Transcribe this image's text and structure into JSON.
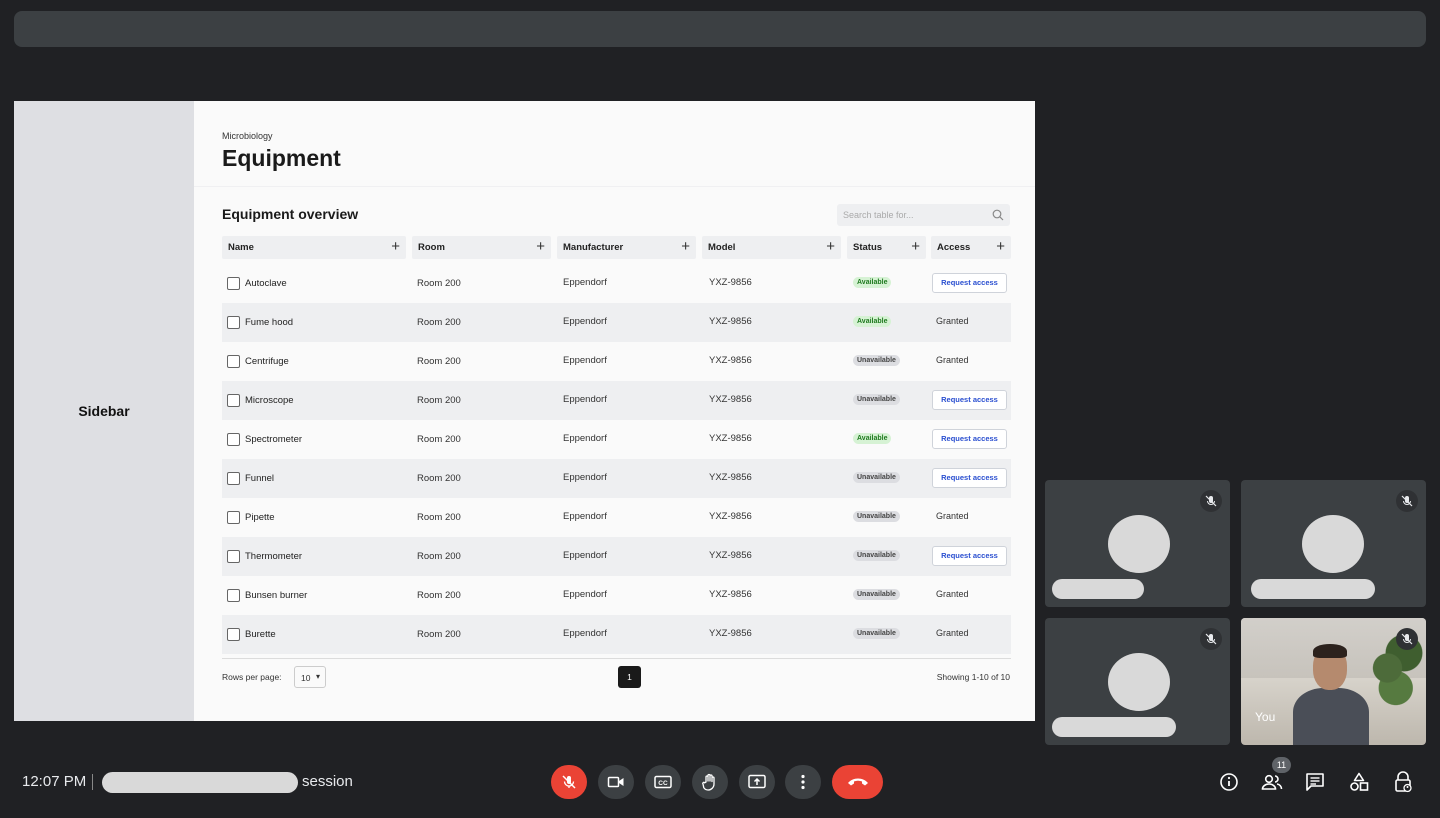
{
  "screen": {
    "sidebar_label": "Sidebar",
    "breadcrumb": "Microbiology",
    "title": "Equipment",
    "section_title": "Equipment overview",
    "search_placeholder": "Search table for...",
    "columns": [
      "Name",
      "Room",
      "Manufacturer",
      "Model",
      "Status",
      "Access"
    ],
    "rows": [
      {
        "name": "Autoclave",
        "room": "Room 200",
        "manufacturer": "Eppendorf",
        "model": "YXZ-9856",
        "status": "Available",
        "access": "Request access"
      },
      {
        "name": "Fume hood",
        "room": "Room 200",
        "manufacturer": "Eppendorf",
        "model": "YXZ-9856",
        "status": "Available",
        "access": "Granted"
      },
      {
        "name": "Centrifuge",
        "room": "Room 200",
        "manufacturer": "Eppendorf",
        "model": "YXZ-9856",
        "status": "Unavailable",
        "access": "Granted"
      },
      {
        "name": "Microscope",
        "room": "Room 200",
        "manufacturer": "Eppendorf",
        "model": "YXZ-9856",
        "status": "Unavailable",
        "access": "Request access"
      },
      {
        "name": "Spectrometer",
        "room": "Room 200",
        "manufacturer": "Eppendorf",
        "model": "YXZ-9856",
        "status": "Available",
        "access": "Request access"
      },
      {
        "name": "Funnel",
        "room": "Room 200",
        "manufacturer": "Eppendorf",
        "model": "YXZ-9856",
        "status": "Unavailable",
        "access": "Request access"
      },
      {
        "name": "Pipette",
        "room": "Room 200",
        "manufacturer": "Eppendorf",
        "model": "YXZ-9856",
        "status": "Unavailable",
        "access": "Granted"
      },
      {
        "name": "Thermometer",
        "room": "Room 200",
        "manufacturer": "Eppendorf",
        "model": "YXZ-9856",
        "status": "Unavailable",
        "access": "Request access"
      },
      {
        "name": "Bunsen burner",
        "room": "Room 200",
        "manufacturer": "Eppendorf",
        "model": "YXZ-9856",
        "status": "Unavailable",
        "access": "Granted"
      },
      {
        "name": "Burette",
        "room": "Room 200",
        "manufacturer": "Eppendorf",
        "model": "YXZ-9856",
        "status": "Unavailable",
        "access": "Granted"
      }
    ],
    "footer": {
      "rows_per_page_label": "Rows per page:",
      "rows_per_page_value": "10",
      "current_page": "1",
      "showing": "Showing 1-10 of 10"
    }
  },
  "tiles": {
    "self_label": "You"
  },
  "bottom_bar": {
    "time": "12:07 PM",
    "meeting_suffix": "session",
    "participant_count": "11"
  },
  "colors": {
    "accent_danger": "#ea4335",
    "background": "#202124",
    "control": "#3c4043"
  }
}
